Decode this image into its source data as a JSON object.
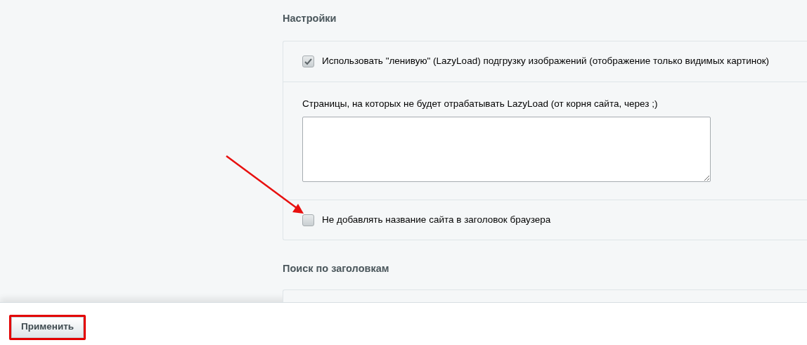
{
  "sections": [
    {
      "title": "Настройки",
      "items": [
        {
          "kind": "checkbox",
          "label": "Использовать \"ленивую\" (LazyLoad) подгрузку изображений (отображение только видимых картинок)",
          "checked": true
        },
        {
          "kind": "textarea",
          "label": "Страницы, на которых не будет отрабатывать LazyLoad (от корня сайта, через ;)"
        },
        {
          "kind": "checkbox",
          "label": "Не добавлять название сайта в заголовок браузера",
          "checked": false
        }
      ]
    },
    {
      "title": "Поиск по заголовкам"
    }
  ],
  "footer": {
    "apply_button": "Применить"
  }
}
